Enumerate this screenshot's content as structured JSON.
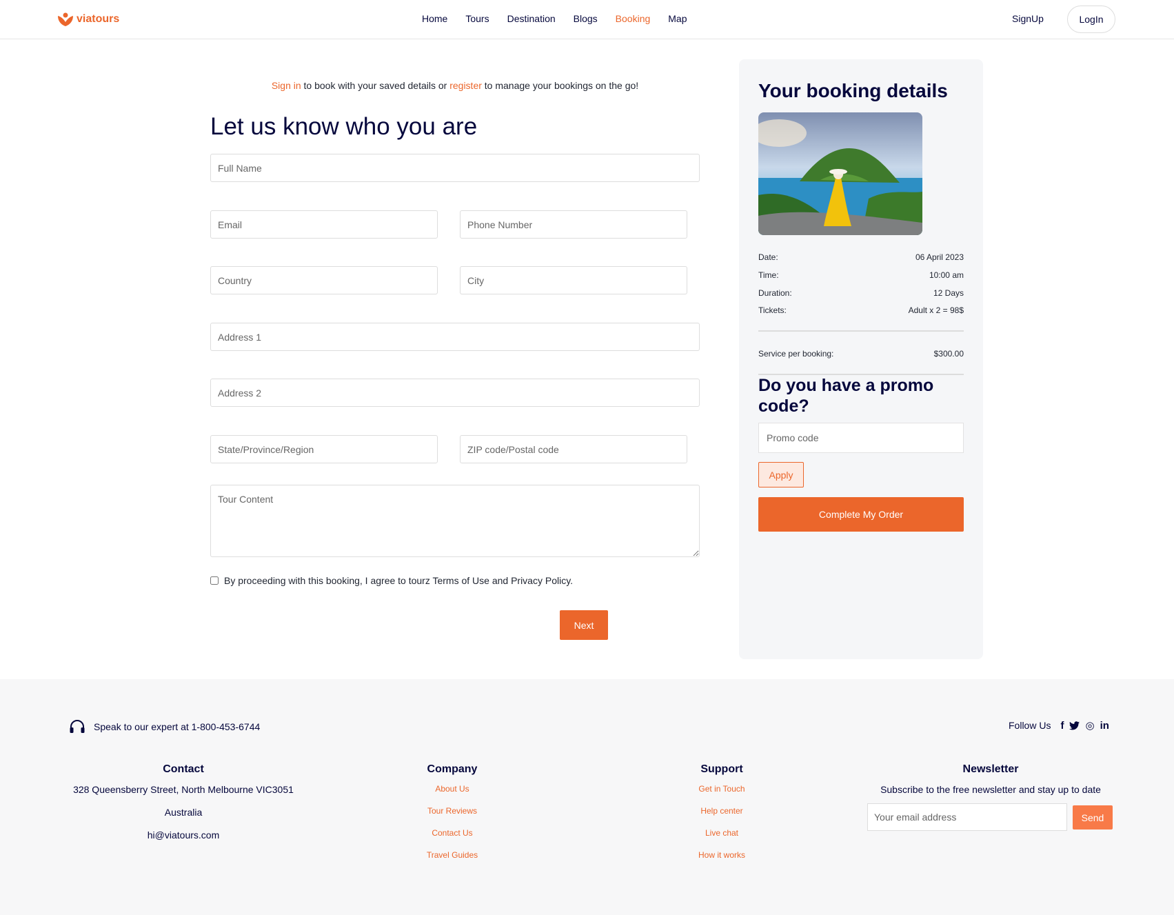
{
  "header": {
    "brand": "viatours",
    "nav": [
      {
        "label": "Home",
        "active": false
      },
      {
        "label": "Tours",
        "active": false
      },
      {
        "label": "Destination",
        "active": false
      },
      {
        "label": "Blogs",
        "active": false
      },
      {
        "label": "Booking",
        "active": true
      },
      {
        "label": "Map",
        "active": false
      }
    ],
    "signup": "SignUp",
    "login": "LogIn"
  },
  "form": {
    "signin_link": "Sign in",
    "signin_mid": " to book with your saved details or ",
    "register_link": "register",
    "signin_end": " to manage your bookings on the go!",
    "title": "Let us know who you are",
    "fields": {
      "full_name": "Full Name",
      "email": "Email",
      "phone": "Phone Number",
      "country": "Country",
      "city": "City",
      "address1": "Address 1",
      "address2": "Address 2",
      "state": "State/Province/Region",
      "zip": "ZIP code/Postal code",
      "tour_content": "Tour Content"
    },
    "agree_text": "By proceeding with this booking, I agree to tourz Terms of Use and Privacy Policy.",
    "next": "Next"
  },
  "booking": {
    "title": "Your booking details",
    "details": [
      {
        "label": "Date:",
        "value": "06 April 2023"
      },
      {
        "label": "Time:",
        "value": "10:00 am"
      },
      {
        "label": "Duration:",
        "value": "12 Days"
      },
      {
        "label": "Tickets:",
        "value": "Adult x 2 = 98$"
      }
    ],
    "service_label": "Service per booking:",
    "service_value": "$300.00",
    "promo_title": "Do you have a promo code?",
    "promo_placeholder": "Promo code",
    "apply": "Apply",
    "complete": "Complete My Order"
  },
  "footer": {
    "expert": "Speak to our expert at 1-800-453-6744",
    "follow": "Follow Us",
    "social": [
      "f",
      "t",
      "◎",
      "in"
    ],
    "contact": {
      "title": "Contact",
      "address": "328 Queensberry Street, North Melbourne VIC3051",
      "country": "Australia",
      "email": "hi@viatours.com"
    },
    "company": {
      "title": "Company",
      "links": [
        "About Us",
        "Tour Reviews",
        "Contact Us",
        "Travel Guides"
      ]
    },
    "support": {
      "title": "Support",
      "links": [
        "Get in Touch",
        "Help center",
        "Live chat",
        "How it works"
      ]
    },
    "newsletter": {
      "title": "Newsletter",
      "text": "Subscribe to the free newsletter and stay up to date",
      "placeholder": "Your email address",
      "send": "Send"
    }
  },
  "colors": {
    "accent": "#eb662b",
    "navy": "#05073c",
    "panel_bg": "#f5f6f8"
  }
}
